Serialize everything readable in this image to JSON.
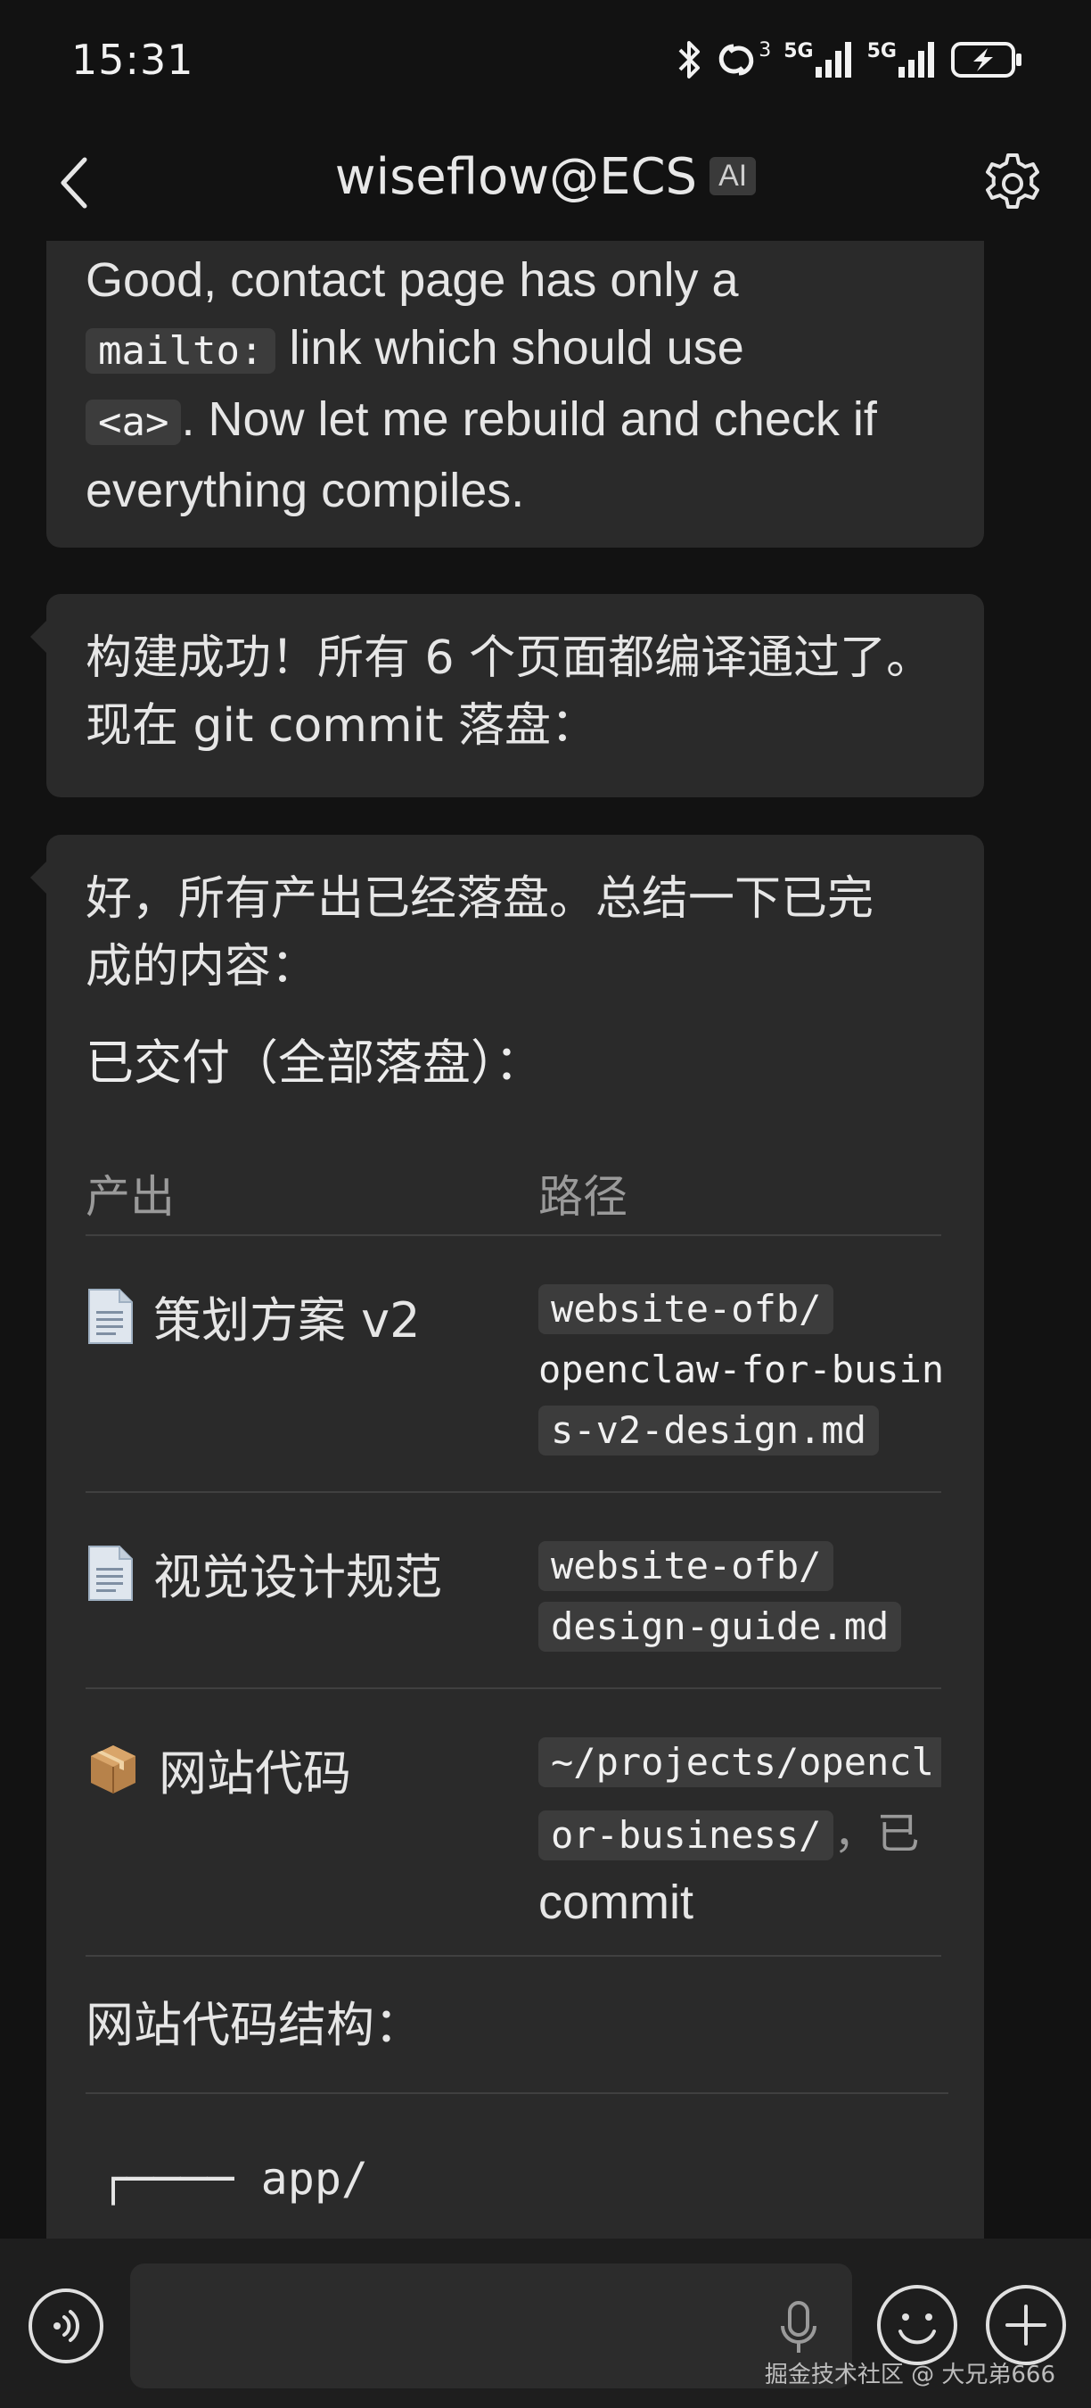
{
  "status_bar": {
    "time": "15:31",
    "network_sup": "3",
    "network_1": "5G",
    "network_2": "5G"
  },
  "header": {
    "title": "wiseflow@ECS",
    "badge": "AI"
  },
  "messages": {
    "m1": {
      "part1": "Good, contact page has only a",
      "code1": "mailto:",
      "part2": " link which should use",
      "code2": "<a>",
      "part3": ". Now let me rebuild and check if everything compiles."
    },
    "m2": {
      "line1": "构建成功！所有 6 个页面都编译通过了。",
      "line2": "现在 git commit 落盘："
    },
    "m3": {
      "intro_1": "好，所有产出已经落盘。总结一下已完",
      "intro_2": "成的内容：",
      "delivered_title": "已交付（全部落盘）：",
      "table": {
        "headers": [
          "产出",
          "路径"
        ],
        "rows": [
          {
            "icon": "page-facing-up",
            "label": "策划方案 v2",
            "path_lines": [
              "website-ofb/",
              "openclaw-for-busin",
              "s-v2-design.md"
            ]
          },
          {
            "icon": "page-facing-up",
            "label": "视觉设计规范",
            "path_lines": [
              "website-ofb/",
              "design-guide.md"
            ]
          },
          {
            "icon": "package",
            "label": "网站代码",
            "path_lines": [
              "~/projects/opencl",
              "or-business/"
            ],
            "suffix": "，已",
            "extra": "commit"
          }
        ]
      },
      "structure_title": "网站代码结构：",
      "tree_line": "┌──── app/"
    }
  },
  "input": {
    "placeholder": "",
    "value": ""
  },
  "watermark": "掘金技术社区 @ 大兄弟666",
  "colors": {
    "background": "#121212",
    "bubble": "#2a2a2a",
    "code_bg": "#3c3c3c",
    "text": "#e6e6e6",
    "muted": "#9a9a9a"
  }
}
